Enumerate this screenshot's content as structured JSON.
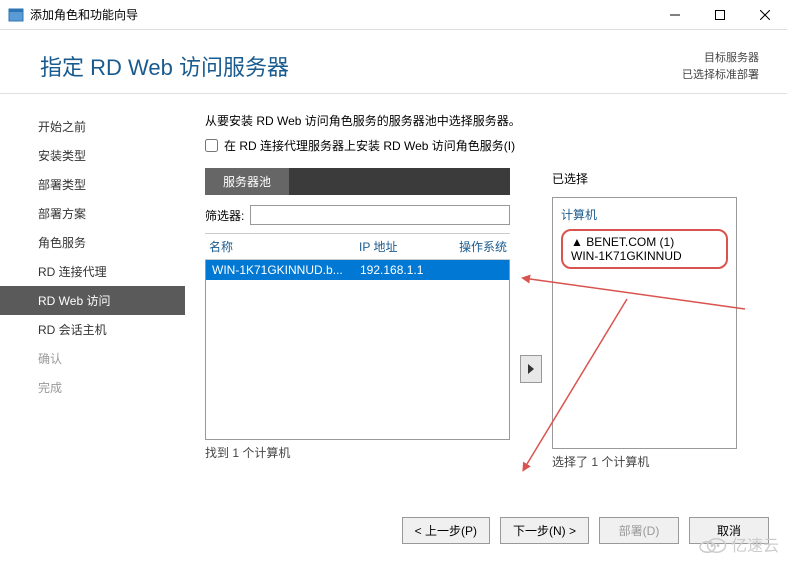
{
  "window": {
    "title": "添加角色和功能向导"
  },
  "header": {
    "heading": "指定 RD Web 访问服务器",
    "dest_label": "目标服务器",
    "dest_value": "已选择标准部署"
  },
  "sidebar": {
    "items": [
      {
        "label": "开始之前",
        "state": "normal"
      },
      {
        "label": "安装类型",
        "state": "normal"
      },
      {
        "label": "部署类型",
        "state": "normal"
      },
      {
        "label": "部署方案",
        "state": "normal"
      },
      {
        "label": "角色服务",
        "state": "normal"
      },
      {
        "label": "RD 连接代理",
        "state": "normal"
      },
      {
        "label": "RD Web 访问",
        "state": "active"
      },
      {
        "label": "RD 会话主机",
        "state": "normal"
      },
      {
        "label": "确认",
        "state": "disabled"
      },
      {
        "label": "完成",
        "state": "disabled"
      }
    ]
  },
  "content": {
    "instruction": "从要安装 RD Web 访问角色服务的服务器池中选择服务器。",
    "checkbox_label": "在 RD 连接代理服务器上安装 RD Web 访问角色服务(I)",
    "pool_tab": "服务器池",
    "filter_label": "筛选器:",
    "filter_value": "",
    "columns": {
      "name": "名称",
      "ip": "IP 地址",
      "os": "操作系统"
    },
    "rows": [
      {
        "name": "WIN-1K71GKINNUD.b...",
        "ip": "192.168.1.1",
        "os": ""
      }
    ],
    "found_text": "找到 1 个计算机",
    "selected_label": "已选择",
    "selected_header": "计算机",
    "selected_domain": "BENET.COM (1)",
    "selected_machine": "WIN-1K71GKINNUD",
    "selected_footer": "选择了 1 个计算机"
  },
  "buttons": {
    "previous": "< 上一步(P)",
    "next": "下一步(N) >",
    "deploy": "部署(D)",
    "cancel": "取消"
  },
  "watermark": "亿速云"
}
